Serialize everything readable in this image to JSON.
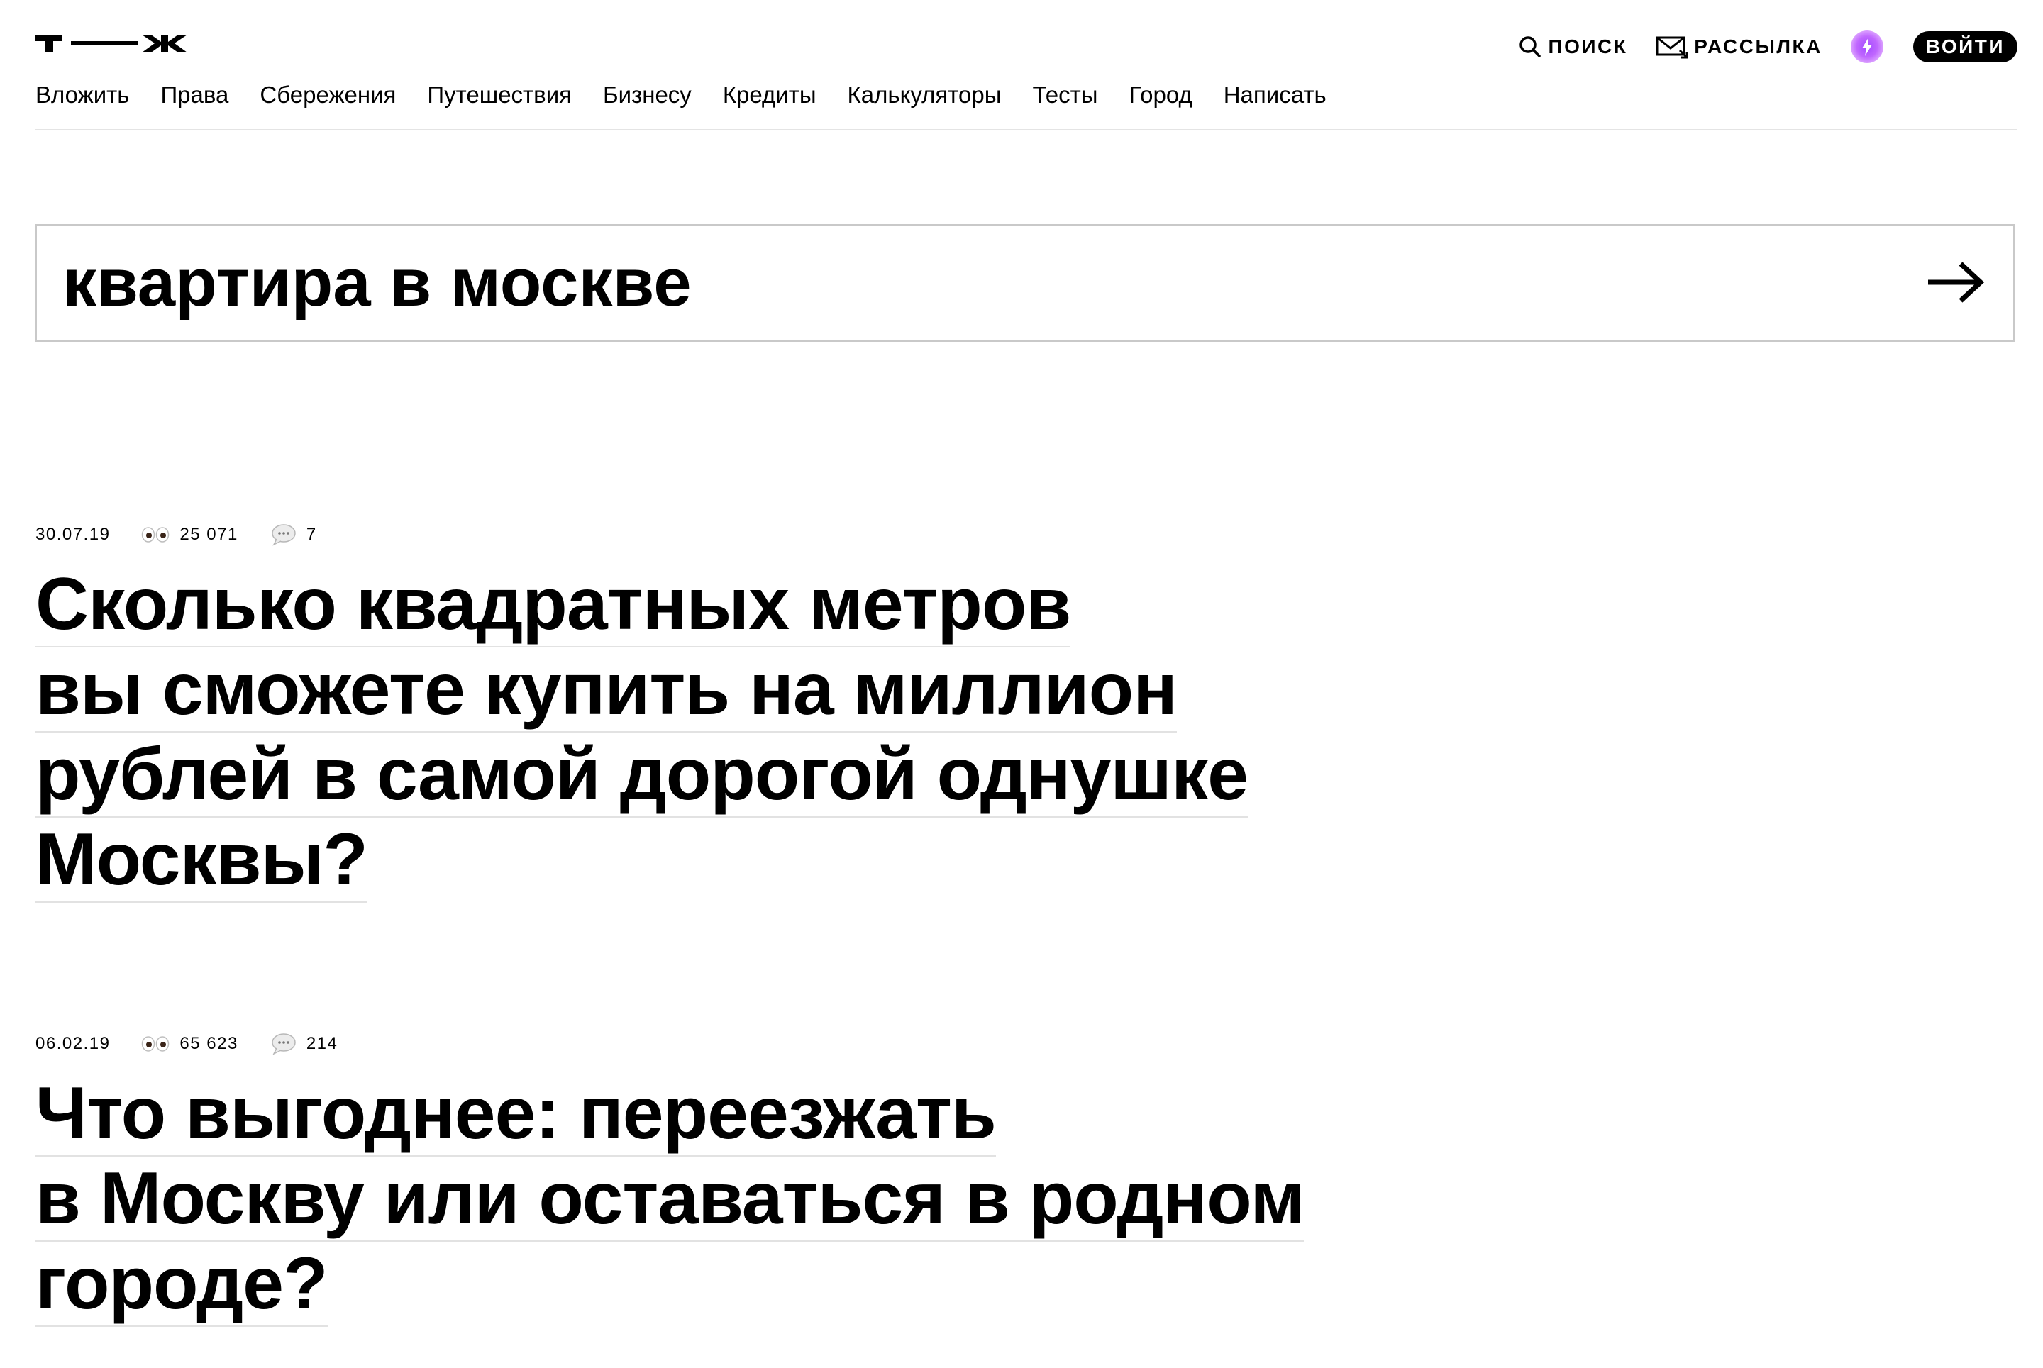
{
  "header": {
    "logo_alt": "Т—Ж",
    "nav": [
      "Вложить",
      "Права",
      "Сбережения",
      "Путешествия",
      "Бизнесу",
      "Кредиты",
      "Калькуляторы",
      "Тесты",
      "Город",
      "Написать"
    ],
    "search_label": "ПОИСК",
    "newsletter_label": "РАССЫЛКА",
    "login_label": "ВОЙТИ",
    "pro_badge_color": "#b65cff"
  },
  "search": {
    "query": "квартира в москве"
  },
  "articles": [
    {
      "date": "30.07.19",
      "views": "25 071",
      "comments": "7",
      "title_lines": [
        "Сколько квадратных метров",
        "вы сможете купить на миллион",
        "рублей в самой дорогой однушке",
        "Москвы?"
      ]
    },
    {
      "date": "06.02.19",
      "views": "65 623",
      "comments": "214",
      "title_lines": [
        "Что выгоднее: переезжать",
        "в Москву или оставаться в родном",
        "городе?"
      ]
    }
  ]
}
